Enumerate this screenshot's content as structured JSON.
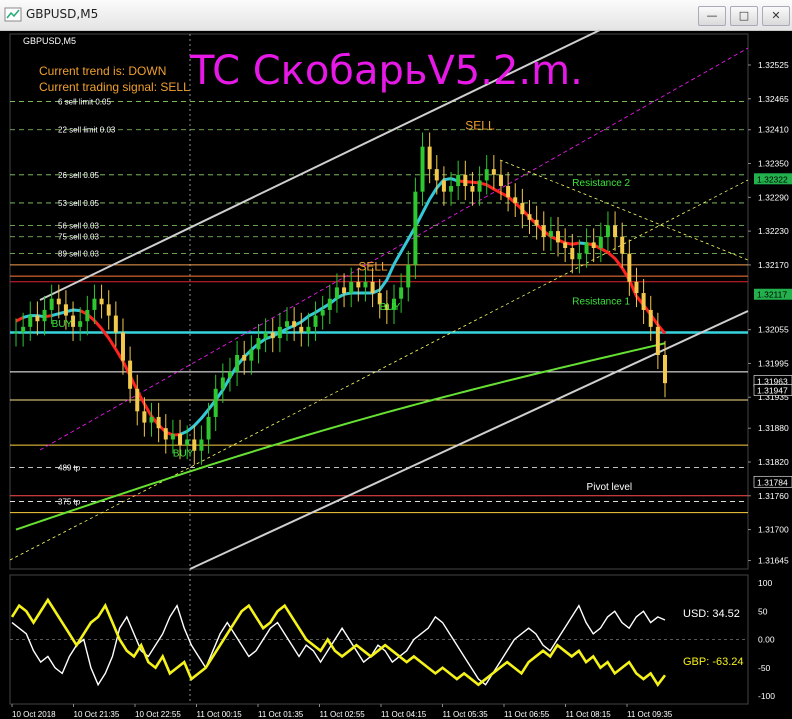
{
  "window": {
    "title": "GBPUSD,M5",
    "minimize_glyph": "—",
    "restore_glyph": "□",
    "close_glyph": "✕"
  },
  "chart_header": {
    "symbol_label": "GBPUSD,M5",
    "big_title": "TC СкобарьV5.2.m.",
    "trend_line": "Current trend is: DOWN",
    "signal_line": "Current trading signal: SELL"
  },
  "colors": {
    "title_magenta": "#e619e6",
    "orange_text": "#f0a030",
    "red_line": "#ff2222",
    "cyan_line": "#35c8d8",
    "green_ma": "#66e033",
    "level_cyan": "#37d4e0",
    "bull_candle": "#2fc72f",
    "bear_candle": "#f2c94c",
    "usd_line": "#ffffff",
    "gbp_line": "#f5f21a"
  },
  "chart_data": [
    {
      "type": "candlestick",
      "price_axis": {
        "ticks": [
          "1.32525",
          "1.32465",
          "1.32410",
          "1.32350",
          "1.32290",
          "1.32230",
          "1.32170",
          "1.32055",
          "1.31995",
          "1.31935",
          "1.31880",
          "1.31820",
          "1.31760",
          "1.31700",
          "1.31645"
        ],
        "ylim": [
          1.3163,
          1.3258
        ],
        "tags": [
          {
            "value": "1.32322",
            "kind": "green"
          },
          {
            "value": "1.32117",
            "kind": "green"
          },
          {
            "value": "1.31963",
            "kind": "white"
          },
          {
            "value": "1.31947",
            "kind": "white"
          },
          {
            "value": "1.31784",
            "kind": "white"
          }
        ]
      },
      "time_ticks": [
        "10 Oct 2018",
        "10 Oct 21:35",
        "10 Oct 22:55",
        "11 Oct 00:15",
        "11 Oct 01:35",
        "11 Oct 02:55",
        "11 Oct 04:15",
        "11 Oct 05:35",
        "11 Oct 06:55",
        "11 Oct 08:15",
        "11 Oct 09:35"
      ],
      "closes": [
        1.3205,
        1.3206,
        1.3208,
        1.3207,
        1.3209,
        1.3211,
        1.321,
        1.3208,
        1.3206,
        1.3207,
        1.3209,
        1.3211,
        1.321,
        1.3208,
        1.3205,
        1.32,
        1.3195,
        1.3191,
        1.3189,
        1.319,
        1.3188,
        1.3186,
        1.3187,
        1.3185,
        1.3186,
        1.3184,
        1.3186,
        1.319,
        1.3195,
        1.3197,
        1.3198,
        1.3201,
        1.32,
        1.3202,
        1.3204,
        1.3205,
        1.3204,
        1.3206,
        1.3207,
        1.3206,
        1.3205,
        1.3206,
        1.3208,
        1.3209,
        1.3211,
        1.3213,
        1.3212,
        1.3214,
        1.3213,
        1.3214,
        1.3212,
        1.321,
        1.3209,
        1.3211,
        1.3213,
        1.3217,
        1.323,
        1.3238,
        1.3234,
        1.3232,
        1.323,
        1.3231,
        1.3233,
        1.3231,
        1.323,
        1.3232,
        1.3234,
        1.3233,
        1.3231,
        1.3229,
        1.3228,
        1.3226,
        1.3225,
        1.3224,
        1.3222,
        1.3223,
        1.3221,
        1.322,
        1.3218,
        1.3219,
        1.3221,
        1.322,
        1.3222,
        1.3224,
        1.3222,
        1.3219,
        1.3214,
        1.3212,
        1.3209,
        1.3206,
        1.3201,
        1.3196
      ],
      "level_labels": [
        {
          "text": "6 sell limit 0.05",
          "price": 1.3246
        },
        {
          "text": "22 sell limit 0.03",
          "price": 1.3241
        },
        {
          "text": "26 sell 0.05",
          "price": 1.3233
        },
        {
          "text": "53 sell 0.05",
          "price": 1.3228
        },
        {
          "text": "56 sell 0.03",
          "price": 1.3224
        },
        {
          "text": "75 sell 0.03",
          "price": 1.3222
        },
        {
          "text": "89 sell 0.03",
          "price": 1.3219
        },
        {
          "text": "489 tp",
          "price": 1.3181
        },
        {
          "text": "375 tp",
          "price": 1.3175
        }
      ],
      "annotations": [
        {
          "text": "SELL",
          "kind": "orange",
          "price": 1.3241,
          "time_index": 63
        },
        {
          "text": "SELL",
          "kind": "orange",
          "price": 1.3216,
          "time_index": 48
        },
        {
          "text": "BUY",
          "kind": "green",
          "price": 1.3206,
          "time_index": 5
        },
        {
          "text": "BUY",
          "kind": "green",
          "price": 1.3209,
          "time_index": 51
        },
        {
          "text": "BUY",
          "kind": "green",
          "price": 1.3183,
          "time_index": 22
        },
        {
          "text": "Resistance 2",
          "kind": "green",
          "price": 1.3231,
          "time_index": 78
        },
        {
          "text": "Resistance 1",
          "kind": "green",
          "price": 1.321,
          "time_index": 78
        },
        {
          "text": "Pivot level",
          "kind": "white",
          "price": 1.3177,
          "time_index": 80
        }
      ]
    },
    {
      "type": "line",
      "ylim": [
        -100,
        100
      ],
      "y_ticks": [
        "100",
        "50",
        "0.00",
        "-50",
        "-100"
      ],
      "series": [
        {
          "name": "USD",
          "value_label": "USD: 34.52",
          "values": [
            30,
            20,
            10,
            -20,
            -40,
            -30,
            -50,
            -60,
            -30,
            -10,
            0,
            -50,
            -80,
            -60,
            -30,
            20,
            40,
            10,
            -20,
            -30,
            -10,
            10,
            40,
            60,
            20,
            -10,
            -30,
            -50,
            -20,
            10,
            30,
            10,
            -10,
            -30,
            -20,
            0,
            20,
            30,
            10,
            -10,
            -30,
            -10,
            -20,
            -40,
            -20,
            0,
            20,
            0,
            -20,
            -40,
            -30,
            -10,
            -20,
            -40,
            -30,
            -20,
            0,
            10,
            20,
            40,
            30,
            10,
            -10,
            -30,
            -50,
            -70,
            -80,
            -60,
            -40,
            -20,
            0,
            10,
            20,
            10,
            -10,
            -20,
            0,
            20,
            40,
            60,
            30,
            10,
            20,
            40,
            50,
            30,
            20,
            40,
            50,
            30,
            40,
            34.52
          ]
        },
        {
          "name": "GBP",
          "value_label": "GBP: -63.24",
          "values": [
            40,
            60,
            50,
            30,
            50,
            70,
            50,
            30,
            10,
            -10,
            10,
            30,
            40,
            60,
            30,
            0,
            -20,
            -30,
            -10,
            -40,
            -50,
            -30,
            -60,
            -50,
            -40,
            -70,
            -60,
            -50,
            -30,
            -10,
            10,
            30,
            50,
            60,
            40,
            20,
            30,
            50,
            60,
            40,
            20,
            0,
            -10,
            -20,
            0,
            -20,
            -30,
            -20,
            -10,
            -20,
            -30,
            -20,
            -10,
            -20,
            -30,
            -40,
            -30,
            -40,
            -50,
            -60,
            -50,
            -60,
            -70,
            -60,
            -70,
            -80,
            -70,
            -60,
            -50,
            -40,
            -50,
            -60,
            -40,
            -30,
            -20,
            -30,
            -10,
            -20,
            -30,
            -20,
            -40,
            -30,
            -50,
            -40,
            -60,
            -50,
            -40,
            -60,
            -70,
            -60,
            -80,
            -63.24
          ]
        }
      ]
    }
  ]
}
